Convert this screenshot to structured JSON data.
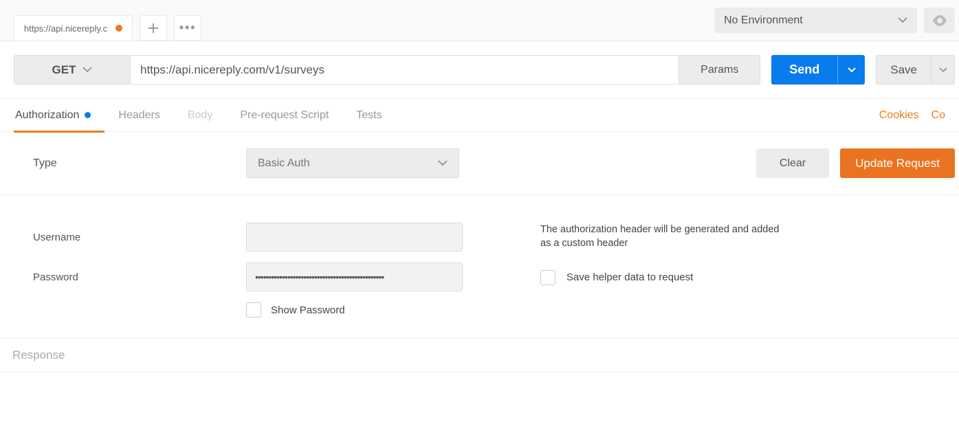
{
  "topbar": {
    "tab_title": "https://api.nicereply.c",
    "env_selected": "No Environment"
  },
  "request": {
    "method": "GET",
    "url": "https://api.nicereply.com/v1/surveys",
    "params_label": "Params",
    "send_label": "Send",
    "save_label": "Save"
  },
  "req_tabs": {
    "authorization": "Authorization",
    "headers": "Headers",
    "body": "Body",
    "pre_request": "Pre-request Script",
    "tests": "Tests"
  },
  "right_links": {
    "cookies": "Cookies",
    "code": "Co"
  },
  "auth": {
    "type_label": "Type",
    "type_selected": "Basic Auth",
    "clear_label": "Clear",
    "update_label": "Update Request",
    "username_label": "Username",
    "username_value": "",
    "password_label": "Password",
    "password_value": "••••••••••••••••••••••••••••••••••••••••••••••••",
    "show_password_label": "Show Password",
    "info_text": "The authorization header will be generated and added as a custom header",
    "save_helper_label": "Save helper data to request"
  },
  "response": {
    "title": "Response"
  }
}
